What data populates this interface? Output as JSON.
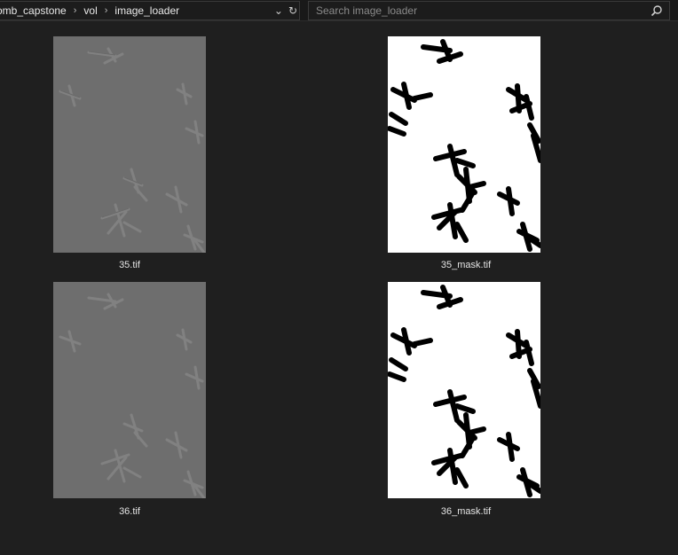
{
  "breadcrumb": {
    "items": [
      "omb_capstone",
      "vol",
      "image_loader"
    ]
  },
  "toolbar": {
    "dropdown_icon": "chevron-down-icon",
    "refresh_icon": "refresh-icon"
  },
  "search": {
    "placeholder": "Search image_loader",
    "value": "",
    "icon": "search-icon"
  },
  "files": [
    {
      "name": "35.tif",
      "kind": "microscopy"
    },
    {
      "name": "35_mask.tif",
      "kind": "mask"
    },
    {
      "name": "36.tif",
      "kind": "microscopy"
    },
    {
      "name": "36_mask.tif",
      "kind": "mask"
    }
  ]
}
